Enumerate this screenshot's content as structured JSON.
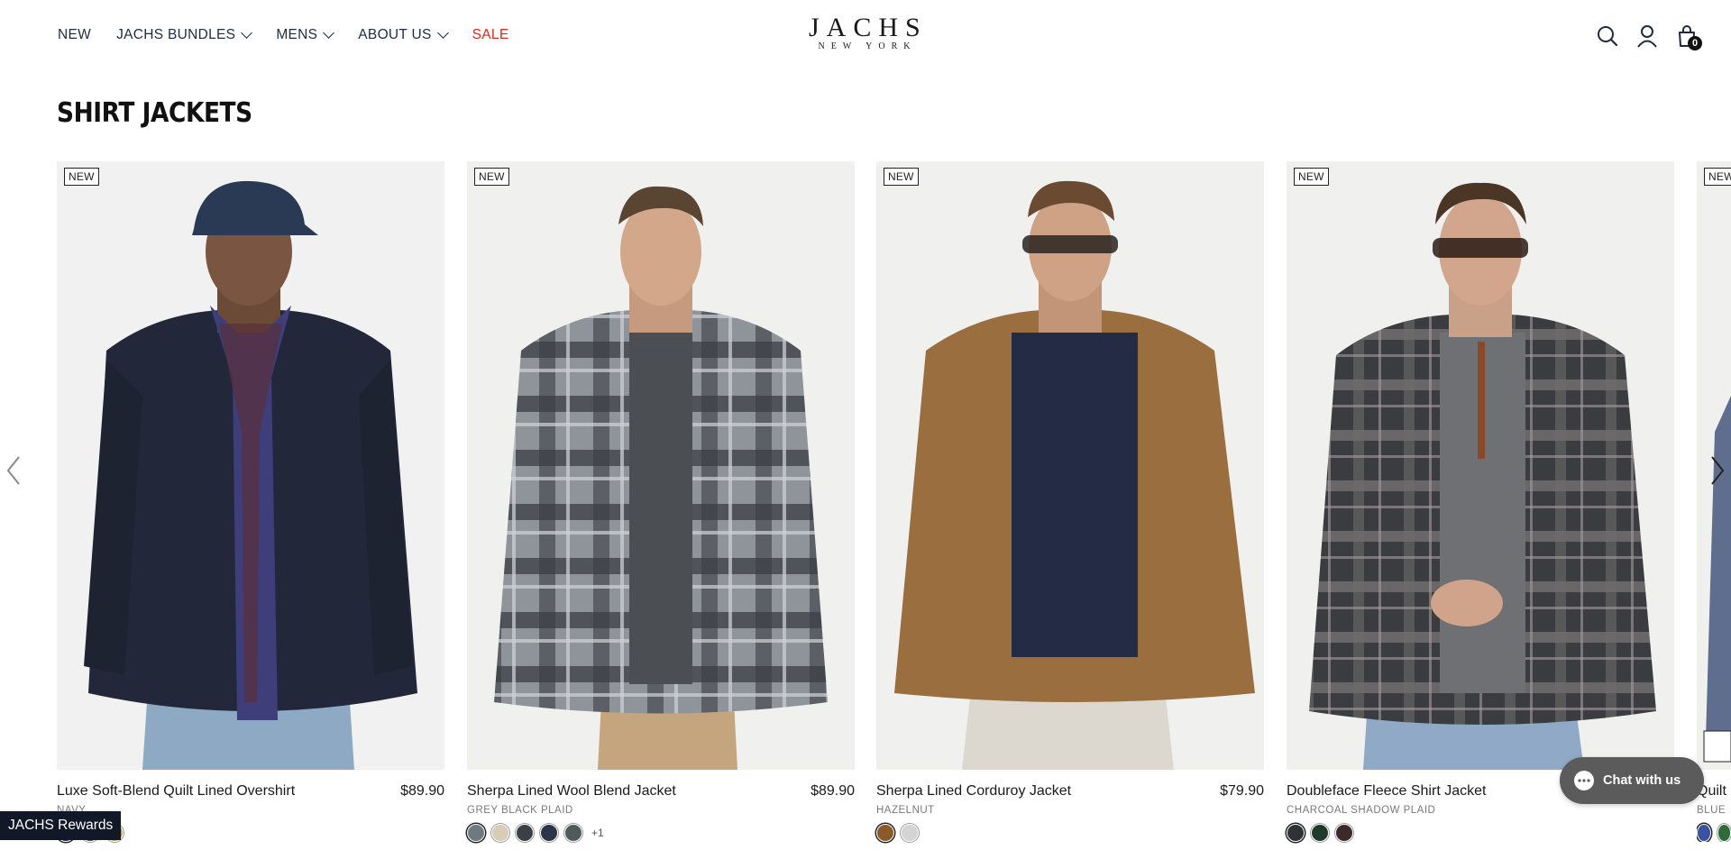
{
  "nav": {
    "items": [
      {
        "label": "NEW",
        "dropdown": false
      },
      {
        "label": "JACHS BUNDLES",
        "dropdown": true
      },
      {
        "label": "MENS",
        "dropdown": true
      },
      {
        "label": "ABOUT US",
        "dropdown": true
      },
      {
        "label": "SALE",
        "dropdown": false
      }
    ]
  },
  "logo": {
    "main": "JACHS",
    "sub": "NEW YORK"
  },
  "header_icons": [
    "search-icon",
    "account-icon",
    "cart-icon"
  ],
  "cart": {
    "count": "0"
  },
  "section": {
    "title": "SHIRT JACKETS"
  },
  "products": [
    {
      "badge": "NEW",
      "name": "Luxe Soft-Blend Quilt Lined Overshirt",
      "price": "$89.90",
      "color": "NAVY",
      "swatches": [
        "#1f2a5a",
        "#3b4a5c",
        "#c9a46a"
      ],
      "more": ""
    },
    {
      "badge": "NEW",
      "name": "Sherpa Lined Wool Blend Jacket",
      "price": "$89.90",
      "color": "GREY BLACK PLAID",
      "swatches": [
        "#6f7a80",
        "#d8ccb8",
        "#3c3f45",
        "#2c3448",
        "#4f5a5a"
      ],
      "more": "+1"
    },
    {
      "badge": "NEW",
      "name": "Sherpa Lined Corduroy Jacket",
      "price": "$79.90",
      "color": "HAZELNUT",
      "swatches": [
        "#8a5a2b",
        "#d4d4d4"
      ],
      "more": ""
    },
    {
      "badge": "NEW",
      "name": "Doubleface Fleece Shirt Jacket",
      "price": "",
      "color": "CHARCOAL SHADOW PLAID",
      "swatches": [
        "#2f3336",
        "#1f3a2a",
        "#3a2a2a"
      ],
      "more": ""
    },
    {
      "badge": "NEW",
      "name": "Quilt",
      "price": "",
      "color": "BLUE",
      "swatches": [
        "#3a52a0",
        "#2f6a3a"
      ],
      "more": ""
    }
  ],
  "chat": {
    "label": "Chat with us"
  },
  "rewards": {
    "label": "JACHS Rewards"
  }
}
